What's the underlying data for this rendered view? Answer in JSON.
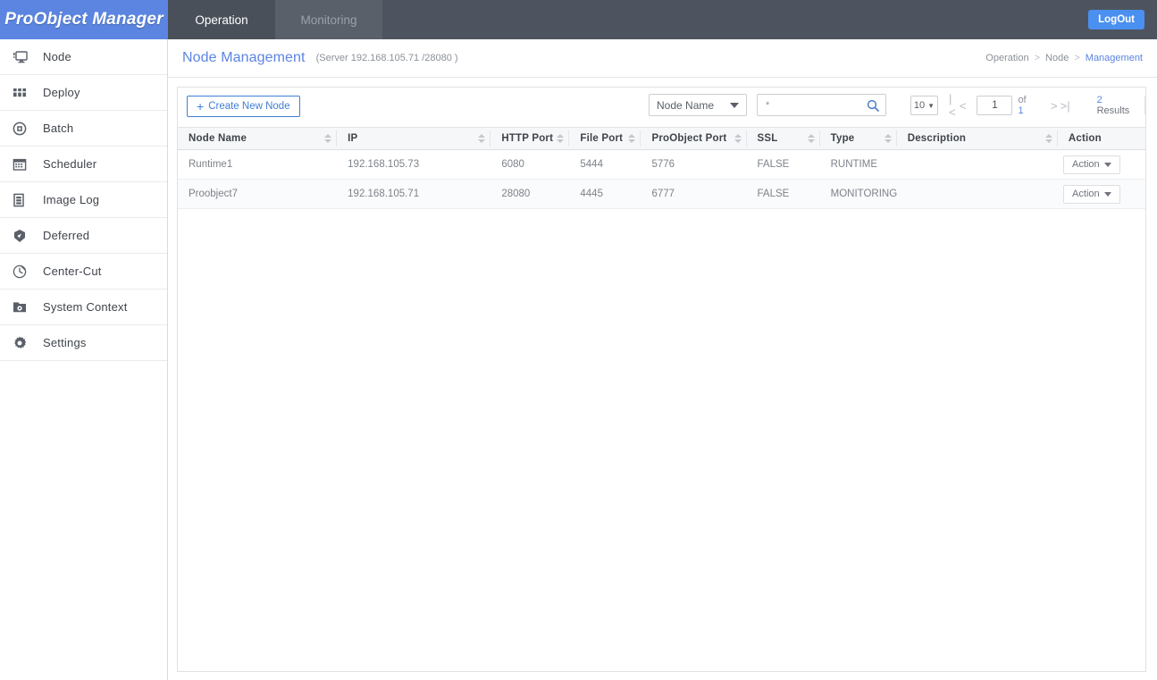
{
  "topbar": {
    "brand": "ProObject Manager",
    "tabs": [
      {
        "label": "Operation",
        "state": "active"
      },
      {
        "label": "Monitoring",
        "state": "inactive"
      }
    ],
    "logout_label": "LogOut",
    "brand_color": "#5b85e0",
    "bar_color": "#4e545f"
  },
  "sidebar": {
    "items": [
      {
        "label": "Node",
        "icon": "monitor-icon"
      },
      {
        "label": "Deploy",
        "icon": "grid-icon"
      },
      {
        "label": "Batch",
        "icon": "batch-icon"
      },
      {
        "label": "Scheduler",
        "icon": "calendar-icon"
      },
      {
        "label": "Image Log",
        "icon": "document-icon"
      },
      {
        "label": "Deferred",
        "icon": "badge-icon"
      },
      {
        "label": "Center-Cut",
        "icon": "clock-icon"
      },
      {
        "label": "System Context",
        "icon": "folder-gear-icon"
      },
      {
        "label": "Settings",
        "icon": "gear-icon"
      }
    ]
  },
  "page": {
    "title": "Node Management",
    "subtitle": "(Server 192.168.105.71 /28080 )",
    "breadcrumb": [
      "Operation",
      "Node",
      "Management"
    ],
    "breadcrumb_separator": ">"
  },
  "toolbar": {
    "create_label": "Create New Node",
    "create_icon": "plus-icon",
    "filter_field": "Node Name",
    "search_value": "*",
    "search_placeholder": "*",
    "search_icon": "search-icon"
  },
  "pagination": {
    "page_size": "10",
    "current_page": "1",
    "of_label": "of",
    "total_pages": "1",
    "results_count": "2",
    "results_label": "Results",
    "first_icon": "|<",
    "prev_icon": "<",
    "next_icon": ">",
    "last_icon": ">|"
  },
  "table": {
    "columns": [
      {
        "label": "Node Name",
        "sortable": true
      },
      {
        "label": "IP",
        "sortable": true
      },
      {
        "label": "HTTP Port",
        "sortable": true
      },
      {
        "label": "File Port",
        "sortable": true
      },
      {
        "label": "ProObject Port",
        "sortable": true
      },
      {
        "label": "SSL",
        "sortable": true
      },
      {
        "label": "Type",
        "sortable": true
      },
      {
        "label": "Description",
        "sortable": true
      },
      {
        "label": "Action",
        "sortable": false
      }
    ],
    "rows": [
      {
        "node_name": "Runtime1",
        "ip": "192.168.105.73",
        "http_port": "6080",
        "file_port": "5444",
        "proobject_port": "5776",
        "ssl": "FALSE",
        "type": "RUNTIME",
        "description": "",
        "action_label": "Action"
      },
      {
        "node_name": "Proobject7",
        "ip": "192.168.105.71",
        "http_port": "28080",
        "file_port": "4445",
        "proobject_port": "6777",
        "ssl": "FALSE",
        "type": "MONITORING",
        "description": "",
        "action_label": "Action"
      }
    ]
  }
}
